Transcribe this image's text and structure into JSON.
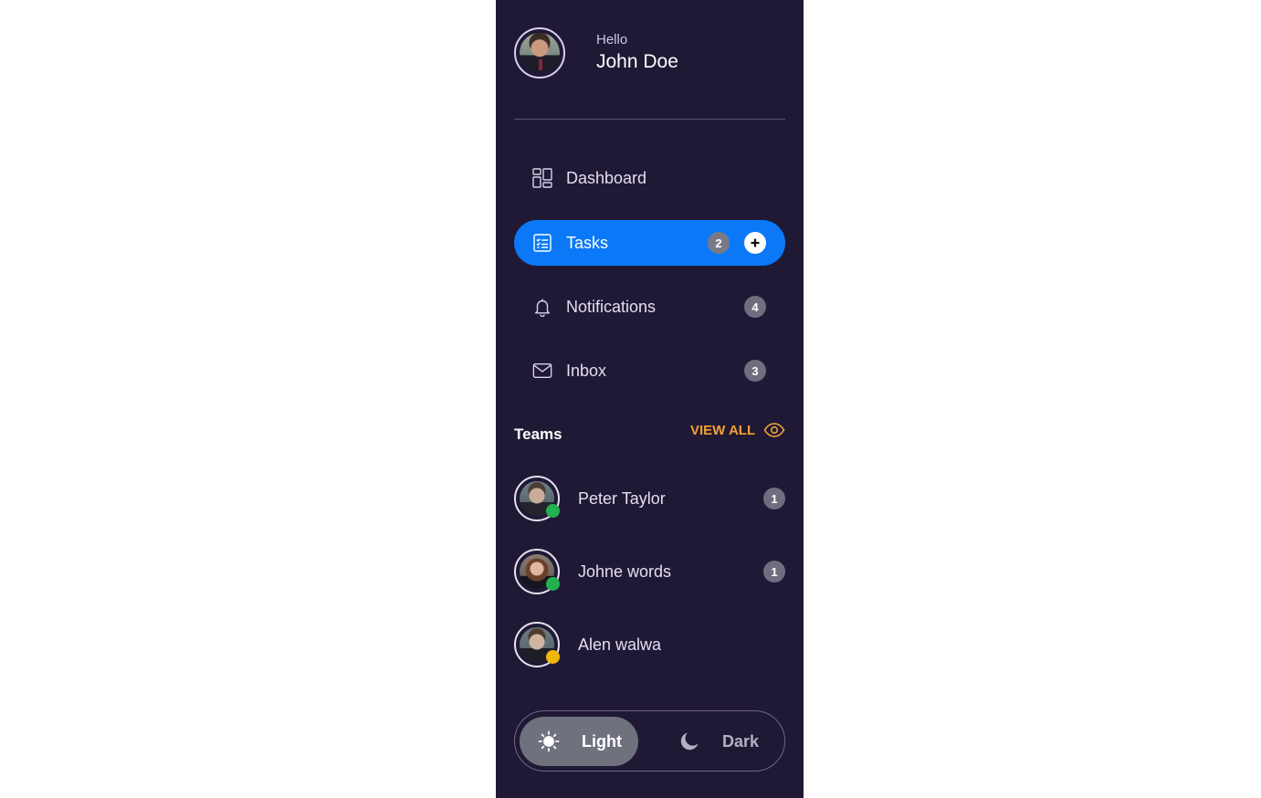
{
  "profile": {
    "greeting": "Hello",
    "name": "John Doe"
  },
  "nav": {
    "items": [
      {
        "label": "Dashboard",
        "icon": "dashboard-icon",
        "active": false
      },
      {
        "label": "Tasks",
        "icon": "tasks-icon",
        "active": true,
        "badge": "2",
        "add_icon": "plus-icon"
      },
      {
        "label": "Notifications",
        "icon": "bell-icon",
        "active": false,
        "badge": "4"
      },
      {
        "label": "Inbox",
        "icon": "mail-icon",
        "active": false,
        "badge": "3"
      }
    ]
  },
  "teams": {
    "title": "Teams",
    "view_all_label": "VIEW ALL",
    "view_all_icon": "eye-icon",
    "members": [
      {
        "name": "Peter Taylor",
        "status": "online",
        "status_color": "#22b14c",
        "badge": "1"
      },
      {
        "name": "Johne words",
        "status": "online",
        "status_color": "#22b14c",
        "badge": "1"
      },
      {
        "name": "Alen walwa",
        "status": "away",
        "status_color": "#f2b705"
      }
    ]
  },
  "theme": {
    "options": [
      {
        "label": "Light",
        "icon": "sun-icon",
        "selected": true
      },
      {
        "label": "Dark",
        "icon": "moon-icon",
        "selected": false
      }
    ]
  },
  "colors": {
    "sidebar_bg": "#201935",
    "accent": "#0b79f7",
    "view_all": "#f0a233",
    "badge": "#6f6e80"
  }
}
